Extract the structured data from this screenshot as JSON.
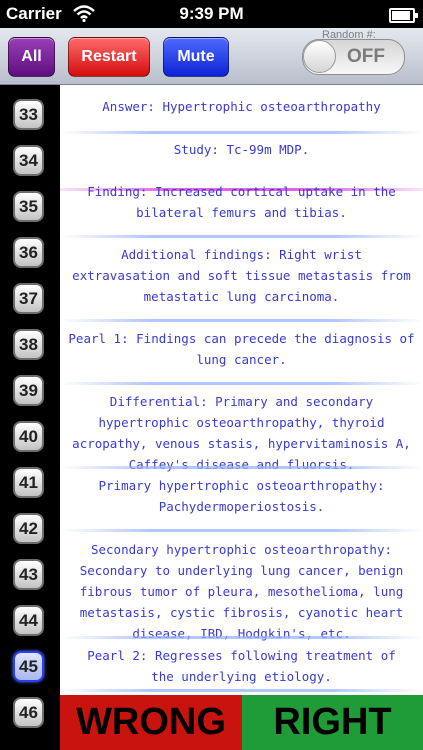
{
  "status": {
    "carrier": "Carrier",
    "time": "9:39 PM"
  },
  "toolbar": {
    "all_label": "All",
    "restart_label": "Restart",
    "mute_label": "Mute",
    "random_label": "Random #:",
    "random_state": "OFF"
  },
  "numbers": [
    {
      "label": "33"
    },
    {
      "label": "34"
    },
    {
      "label": "35"
    },
    {
      "label": "36"
    },
    {
      "label": "37"
    },
    {
      "label": "38"
    },
    {
      "label": "39"
    },
    {
      "label": "40"
    },
    {
      "label": "41"
    },
    {
      "label": "42"
    },
    {
      "label": "43"
    },
    {
      "label": "44"
    },
    {
      "label": "45",
      "active": true
    },
    {
      "label": "46"
    }
  ],
  "content": [
    {
      "text": "Answer: Hypertrophic osteoarthropathy"
    },
    {
      "text": "Study: Tc-99m MDP."
    },
    {
      "text": "Finding: Increased cortical uptake in the bilateral femurs and tibias."
    },
    {
      "text": "Additional findings: Right wrist extravasation and soft tissue metastasis from metastatic lung carcinoma."
    },
    {
      "text": "Pearl 1: Findings can precede the diagnosis of lung cancer."
    },
    {
      "text": "Differential: Primary and secondary hypertrophic osteoarthropathy, thyroid acropathy, venous stasis, hypervitaminosis A, Caffey's disease and fluorsis."
    },
    {
      "text": "Primary hypertrophic osteoarthropathy: Pachydermoperiostosis."
    },
    {
      "text": "Secondary hypertrophic osteoarthropathy: Secondary to underlying lung cancer, benign fibrous tumor of pleura, mesothelioma, lung metastasis, cystic fibrosis, cyanotic heart disease, IBD, Hodgkin's, etc."
    },
    {
      "text": "Pearl 2: Regresses following treatment of the underlying etiology."
    }
  ],
  "answer_buttons": {
    "wrong_label": "WRONG",
    "right_label": "RIGHT"
  },
  "colors": {
    "text_blue": "#3a3ad2",
    "all_purple": "#5d0f7e",
    "restart_red": "#d40d0d",
    "mute_blue": "#0e22d6",
    "wrong_red": "#c8130f",
    "right_green": "#1f9b37",
    "highlight_pink": "#e15ae1"
  },
  "icons": {
    "wifi": "wifi-icon",
    "battery": "battery-icon"
  }
}
